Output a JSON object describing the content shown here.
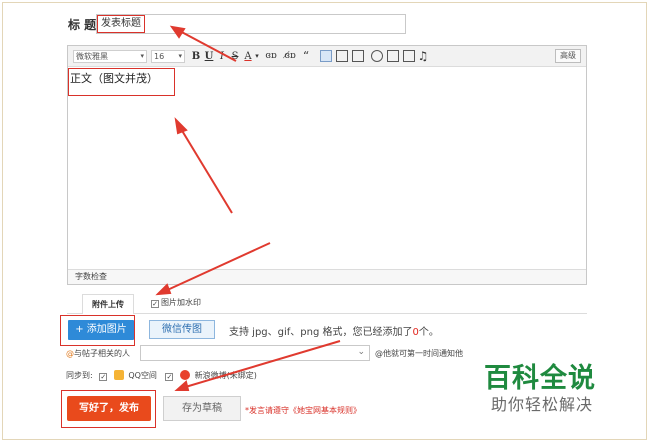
{
  "title_field": {
    "label": "标 题",
    "value": "发表标题"
  },
  "toolbar": {
    "font": "微软雅黑",
    "size": "16",
    "bold": "B",
    "underline": "U",
    "italic": "I",
    "strike": "S",
    "font_color": "A",
    "link": "ɞɒ",
    "unlink": "ɞ̸ɒ",
    "quote": "“",
    "music": "♫",
    "advanced": "高级"
  },
  "editor": {
    "content": "正文（图文并茂）",
    "word_count": "字数检查"
  },
  "attachments": {
    "tab_label": "附件上传",
    "watermark_label": "图片加水印",
    "watermark_checked": true,
    "add_image": "+ 添加图片",
    "weixin_upload": "微信传图",
    "support_prefix": "支持 jpg、gif、png 格式，您已经添加了",
    "support_count": "0",
    "support_suffix": "个。"
  },
  "related": {
    "at": "@",
    "label": "与帖子相关的人",
    "hint": "@他就可第一时间通知他"
  },
  "sync": {
    "label": "同步到:",
    "qzone": "QQ空间",
    "weibo": "新浪微博",
    "weibo_bind": "(未绑定)"
  },
  "actions": {
    "publish": "写好了，发布",
    "save_draft": "存为草稿",
    "rules": "*发言请遵守《她宝网基本规则》"
  },
  "brand": {
    "title": "百科全说",
    "subtitle": "助你轻松解决"
  },
  "colors": {
    "highlight_red": "#d9322a",
    "add_image_blue": "#2e8ad8",
    "publish_orange": "#e94a1c",
    "brand_green": "#1f8a3f"
  }
}
